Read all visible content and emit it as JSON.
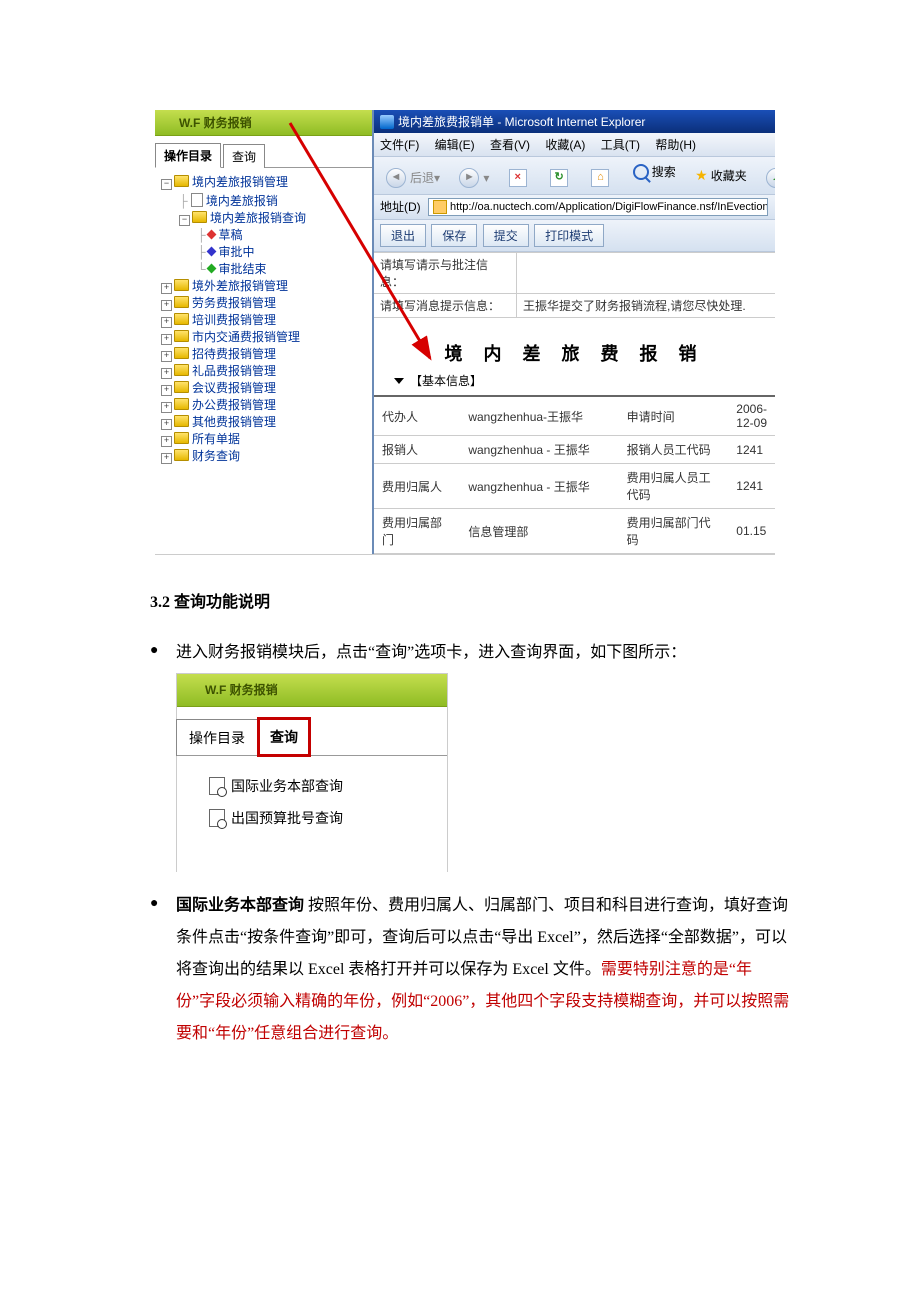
{
  "shot1": {
    "wf_title": "W.F 财务报销",
    "tabs": {
      "ops": "操作目录",
      "query": "查询"
    },
    "tree": {
      "n1": "境内差旅报销管理",
      "n1a": "境内差旅报销",
      "n1b": "境内差旅报销查询",
      "n1b1": "草稿",
      "n1b2": "审批中",
      "n1b3": "审批结束",
      "n2": "境外差旅报销管理",
      "n3": "劳务费报销管理",
      "n4": "培训费报销管理",
      "n5": "市内交通费报销管理",
      "n6": "招待费报销管理",
      "n7": "礼品费报销管理",
      "n8": "会议费报销管理",
      "n9": "办公费报销管理",
      "n10": "其他费报销管理",
      "n11": "所有单据",
      "n12": "财务查询"
    },
    "ie": {
      "title": "境内差旅费报销单 - Microsoft Internet Explorer",
      "menu": {
        "file": "文件(F)",
        "edit": "编辑(E)",
        "view": "查看(V)",
        "fav": "收藏(A)",
        "tools": "工具(T)",
        "help": "帮助(H)"
      },
      "back": "后退",
      "search": "搜索",
      "favbtn": "收藏夹",
      "addr_label": "地址(D)",
      "url": "http://oa.nuctech.com/Application/DigiFlowFinance.nsf/InEvectionForm?O",
      "actions": {
        "exit": "退出",
        "save": "保存",
        "submit": "提交",
        "print": "打印模式"
      }
    },
    "msg": {
      "row1_l": "请填写请示与批注信息：",
      "row1_r": "",
      "row2_l": "请填写消息提示信息：",
      "row2_r": "王振华提交了财务报销流程,请您尽快处理."
    },
    "form_title": "境 内 差 旅 费 报 销",
    "section": "【基本信息】",
    "table": {
      "r1l": "代办人",
      "r1v": "wangzhenhua-王振华",
      "r1l2": "申请时间",
      "r1v2": "2006-12-09",
      "r2l": "报销人",
      "r2v": "wangzhenhua - 王振华",
      "r2l2": "报销人员工代码",
      "r2v2": "1241",
      "r3l": "费用归属人",
      "r3v": "wangzhenhua - 王振华",
      "r3l2": "费用归属人员工代码",
      "r3v2": "1241",
      "r4l": "费用归属部门",
      "r4v": "信息管理部",
      "r4l2": "费用归属部门代码",
      "r4v2": "01.15"
    }
  },
  "doc": {
    "h3": "3.2 查询功能说明",
    "p1": "进入财务报销模块后，点击“查询”选项卡，进入查询界面，如下图所示：",
    "p2_bold": "国际业务本部查询",
    "p2_rest1": " 按照年份、费用归属人、归属部门、项目和科目进行查询，填好查询条件点击“按条件查询”即可，查询后可以点击“导出 Excel”，然后选择“全部数据”，可以将查询出的结果以 Excel 表格打开并可以保存为 Excel 文件。",
    "p2_red": "需要特别注意的是“年份”字段必须输入精确的年份，例如“2006”，其他四个字段支持模糊查询，并可以按照需要和“年份”任意组合进行查询。"
  },
  "shot2": {
    "wf_title": "W.F 财务报销",
    "tab_ops": "操作目录",
    "tab_query": "查询",
    "items": {
      "a": "国际业务本部查询",
      "b": "出国预算批号查询"
    }
  }
}
